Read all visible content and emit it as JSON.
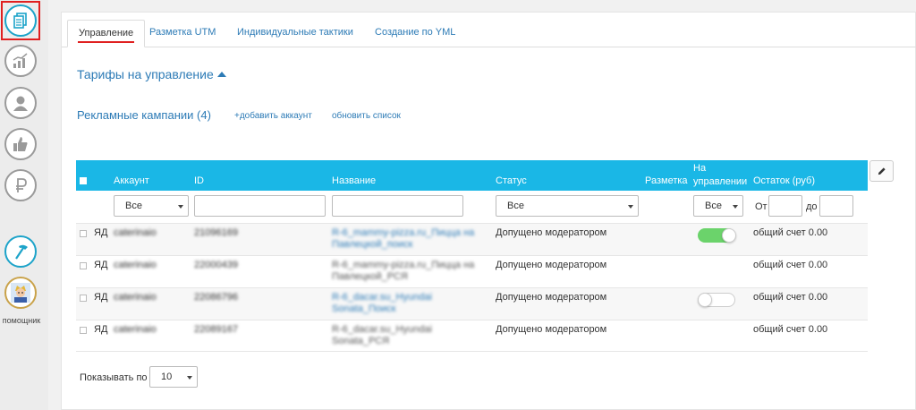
{
  "sidebar": {
    "items": [
      {
        "name": "documents-icon",
        "active": true
      },
      {
        "name": "chart-growth-icon",
        "active": false
      },
      {
        "name": "user-icon",
        "active": false
      },
      {
        "name": "thumbs-up-icon",
        "active": false
      },
      {
        "name": "ruble-icon",
        "active": false
      },
      {
        "name": "hammer-icon",
        "active": false
      }
    ],
    "assistant_label": "помощник",
    "accent": "#1ca3c9",
    "active_outline": "#e02020"
  },
  "tabs": [
    {
      "label": "Управление",
      "active": true
    },
    {
      "label": "Разметка UTM",
      "active": false
    },
    {
      "label": "Индивидуальные тактики",
      "active": false
    },
    {
      "label": "Создание по YML",
      "active": false
    }
  ],
  "tariffs_title": "Тарифы на управление",
  "campaigns": {
    "title": "Рекламные кампании (4)",
    "add_account": "+добавить аккаунт",
    "refresh_list": "обновить список"
  },
  "table": {
    "header_color": "#1ab7e6",
    "columns": {
      "account": "Аккаунт",
      "id": "ID",
      "name": "Название",
      "status": "Статус",
      "markup": "Разметка",
      "managed_line1": "На",
      "managed_line2": "управлении",
      "balance": "Остаток (руб)"
    },
    "filters": {
      "account": "Все",
      "status": "Все",
      "managed": "Все",
      "from_label": "От",
      "to_label": "до",
      "id_value": "",
      "name_value": "",
      "from_value": "",
      "to_value": ""
    },
    "rows": [
      {
        "system": "ЯД",
        "account": "caterinaio",
        "id": "21096169",
        "name_line1": "R-6_mammy-pizza.ru_Пицца на",
        "name_line2": "Павлецкой_поиск",
        "status": "Допущено модератором",
        "managed": "on",
        "balance": "общий счет 0.00",
        "link": true
      },
      {
        "system": "ЯД",
        "account": "caterinaio",
        "id": "22000439",
        "name_line1": "R-6_mammy-pizza.ru_Пицца на",
        "name_line2": "Павлецкой_РСЯ",
        "status": "Допущено модератором",
        "managed": "none",
        "balance": "общий счет 0.00",
        "link": false
      },
      {
        "system": "ЯД",
        "account": "caterinaio",
        "id": "22086796",
        "name_line1": "R-6_dacar.su_Hyundai",
        "name_line2": "Sonata_Поиск",
        "status": "Допущено модератором",
        "managed": "off",
        "balance": "общий счет 0.00",
        "link": true
      },
      {
        "system": "ЯД",
        "account": "caterinaio",
        "id": "22089167",
        "name_line1": "R-6_dacar.su_Hyundai",
        "name_line2": "Sonata_РСЯ",
        "status": "Допущено модератором",
        "managed": "none",
        "balance": "общий счет 0.00",
        "link": false
      }
    ]
  },
  "pagination": {
    "label": "Показывать по",
    "value": "10"
  }
}
